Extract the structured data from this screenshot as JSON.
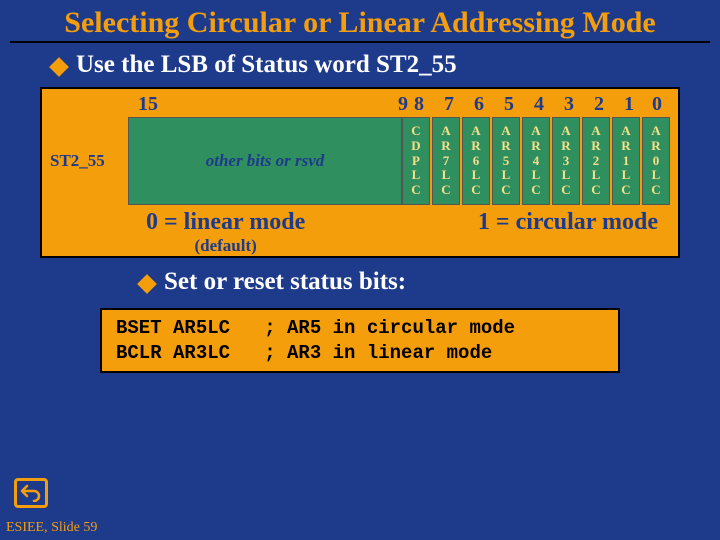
{
  "title": "Selecting Circular or Linear Addressing Mode",
  "bullet1": "Use the LSB of Status word ST2_55",
  "bullet2": "Set or reset status bits:",
  "chart_data": {
    "type": "table",
    "register": "ST2_55",
    "other_bits_label": "other bits or rsvd",
    "bit_index_left": "15",
    "bit_indices_right": [
      "9",
      "8",
      "7",
      "6",
      "5",
      "4",
      "3",
      "2",
      "1",
      "0"
    ],
    "fields": [
      {
        "bit": 8,
        "chars": [
          "C",
          "D",
          "P",
          "L",
          "C"
        ]
      },
      {
        "bit": 7,
        "chars": [
          "A",
          "R",
          "7",
          "L",
          "C"
        ]
      },
      {
        "bit": 6,
        "chars": [
          "A",
          "R",
          "6",
          "L",
          "C"
        ]
      },
      {
        "bit": 5,
        "chars": [
          "A",
          "R",
          "5",
          "L",
          "C"
        ]
      },
      {
        "bit": 4,
        "chars": [
          "A",
          "R",
          "4",
          "L",
          "C"
        ]
      },
      {
        "bit": 3,
        "chars": [
          "A",
          "R",
          "3",
          "L",
          "C"
        ]
      },
      {
        "bit": 2,
        "chars": [
          "A",
          "R",
          "2",
          "L",
          "C"
        ]
      },
      {
        "bit": 1,
        "chars": [
          "A",
          "R",
          "1",
          "L",
          "C"
        ]
      },
      {
        "bit": 0,
        "chars": [
          "A",
          "R",
          "0",
          "L",
          "C"
        ]
      }
    ],
    "mode0": "0 = linear mode",
    "mode0_default": "(default)",
    "mode1": "1 = circular mode"
  },
  "code": {
    "line1": "BSET AR5LC   ; AR5 in circular mode",
    "line2": "BCLR AR3LC   ; AR3 in linear mode"
  },
  "footer": "ESIEE, Slide 59"
}
